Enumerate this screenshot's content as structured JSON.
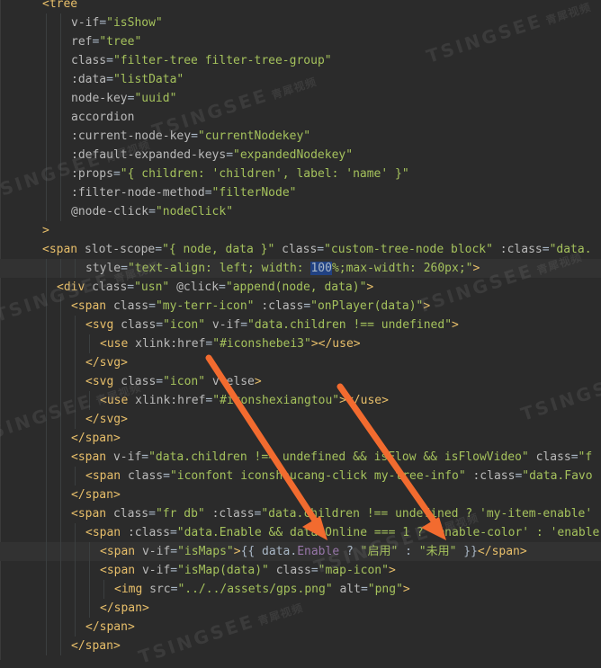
{
  "editor": {
    "lines": [
      {
        "indent": 0,
        "hl": false,
        "tokens": [
          [
            "tag",
            "<tree"
          ]
        ]
      },
      {
        "indent": 2,
        "hl": false,
        "tokens": [
          [
            "attr",
            "v-if"
          ],
          [
            "plain",
            "="
          ],
          [
            "str",
            "\"isShow\""
          ]
        ]
      },
      {
        "indent": 2,
        "hl": false,
        "tokens": [
          [
            "attr",
            "ref"
          ],
          [
            "plain",
            "="
          ],
          [
            "str",
            "\"tree\""
          ]
        ]
      },
      {
        "indent": 2,
        "hl": false,
        "tokens": [
          [
            "attr",
            "class"
          ],
          [
            "plain",
            "="
          ],
          [
            "str",
            "\"filter-tree filter-tree-group\""
          ]
        ]
      },
      {
        "indent": 2,
        "hl": false,
        "tokens": [
          [
            "attr",
            ":data"
          ],
          [
            "plain",
            "="
          ],
          [
            "str",
            "\"listData\""
          ]
        ]
      },
      {
        "indent": 2,
        "hl": false,
        "tokens": [
          [
            "attr",
            "node-key"
          ],
          [
            "plain",
            "="
          ],
          [
            "str",
            "\"uuid\""
          ]
        ]
      },
      {
        "indent": 2,
        "hl": false,
        "tokens": [
          [
            "attr",
            "accordion"
          ]
        ]
      },
      {
        "indent": 2,
        "hl": false,
        "tokens": [
          [
            "attr",
            ":current-node-key"
          ],
          [
            "plain",
            "="
          ],
          [
            "str",
            "\"currentNodekey\""
          ]
        ]
      },
      {
        "indent": 2,
        "hl": false,
        "tokens": [
          [
            "attr",
            ":default-expanded-keys"
          ],
          [
            "plain",
            "="
          ],
          [
            "str",
            "\"expandedNodekey\""
          ]
        ]
      },
      {
        "indent": 2,
        "hl": false,
        "tokens": [
          [
            "attr",
            ":props"
          ],
          [
            "plain",
            "="
          ],
          [
            "str",
            "\"{ children: 'children', label: 'name' }\""
          ]
        ]
      },
      {
        "indent": 2,
        "hl": false,
        "tokens": [
          [
            "attr",
            ":filter-node-method"
          ],
          [
            "plain",
            "="
          ],
          [
            "str",
            "\"filterNode\""
          ]
        ]
      },
      {
        "indent": 2,
        "hl": false,
        "tokens": [
          [
            "attr",
            "@node-click"
          ],
          [
            "plain",
            "="
          ],
          [
            "str",
            "\"nodeClick\""
          ]
        ]
      },
      {
        "indent": 0,
        "hl": false,
        "tokens": [
          [
            "tag",
            ">"
          ]
        ]
      },
      {
        "indent": 0,
        "hl": false,
        "tokens": [
          [
            "tag",
            "<span "
          ],
          [
            "attr",
            "slot-scope"
          ],
          [
            "plain",
            "="
          ],
          [
            "str",
            "\"{ node, data }\" "
          ],
          [
            "attr",
            "class"
          ],
          [
            "plain",
            "="
          ],
          [
            "str",
            "\"custom-tree-node block\" "
          ],
          [
            "attr",
            ":class"
          ],
          [
            "plain",
            "="
          ],
          [
            "str",
            "\"data."
          ]
        ]
      },
      {
        "indent": 3,
        "hl": true,
        "tokens": [
          [
            "attr",
            "style"
          ],
          [
            "plain",
            "="
          ],
          [
            "str",
            "\"text-align: left; width: "
          ],
          [
            "sel",
            "100"
          ],
          [
            "str",
            "%;max-width: 260px;\""
          ],
          [
            "tag",
            ">"
          ]
        ]
      },
      {
        "indent": 1,
        "hl": false,
        "tokens": [
          [
            "tag",
            "<div "
          ],
          [
            "attr",
            "class"
          ],
          [
            "plain",
            "="
          ],
          [
            "str",
            "\"usn\" "
          ],
          [
            "attr",
            "@click"
          ],
          [
            "plain",
            "="
          ],
          [
            "str",
            "\"append(node, data)\""
          ],
          [
            "tag",
            ">"
          ]
        ]
      },
      {
        "indent": 2,
        "hl": false,
        "tokens": [
          [
            "tag",
            "<span "
          ],
          [
            "attr",
            "class"
          ],
          [
            "plain",
            "="
          ],
          [
            "str",
            "\"my-terr-icon\" "
          ],
          [
            "attr",
            ":class"
          ],
          [
            "plain",
            "="
          ],
          [
            "str",
            "\"onPlayer(data)\""
          ],
          [
            "tag",
            ">"
          ]
        ]
      },
      {
        "indent": 3,
        "hl": false,
        "tokens": [
          [
            "tag",
            "<svg "
          ],
          [
            "attr",
            "class"
          ],
          [
            "plain",
            "="
          ],
          [
            "str",
            "\"icon\" "
          ],
          [
            "attr",
            "v-if"
          ],
          [
            "plain",
            "="
          ],
          [
            "str",
            "\"data.children !== undefined\""
          ],
          [
            "tag",
            ">"
          ]
        ]
      },
      {
        "indent": 4,
        "hl": false,
        "tokens": [
          [
            "tag",
            "<use "
          ],
          [
            "attr",
            "xlink:href"
          ],
          [
            "plain",
            "="
          ],
          [
            "str",
            "\"#iconshebei3\""
          ],
          [
            "tag",
            "></use>"
          ]
        ]
      },
      {
        "indent": 3,
        "hl": false,
        "tokens": [
          [
            "tag",
            "</svg>"
          ]
        ]
      },
      {
        "indent": 3,
        "hl": false,
        "tokens": [
          [
            "tag",
            "<svg "
          ],
          [
            "attr",
            "class"
          ],
          [
            "plain",
            "="
          ],
          [
            "str",
            "\"icon\" "
          ],
          [
            "attr",
            "v-else"
          ],
          [
            "tag",
            ">"
          ]
        ]
      },
      {
        "indent": 4,
        "hl": false,
        "tokens": [
          [
            "tag",
            "<use "
          ],
          [
            "attr",
            "xlink:href"
          ],
          [
            "plain",
            "="
          ],
          [
            "str",
            "\"#iconshexiangtou\""
          ],
          [
            "tag",
            "></use>"
          ]
        ]
      },
      {
        "indent": 3,
        "hl": false,
        "tokens": [
          [
            "tag",
            "</svg>"
          ]
        ]
      },
      {
        "indent": 2,
        "hl": false,
        "tokens": [
          [
            "tag",
            "</span>"
          ]
        ]
      },
      {
        "indent": 2,
        "hl": false,
        "tokens": [
          [
            "tag",
            "<span "
          ],
          [
            "attr",
            "v-if"
          ],
          [
            "plain",
            "="
          ],
          [
            "str",
            "\"data.children !== undefined && isFlow && isFlowVideo\" "
          ],
          [
            "attr",
            "class"
          ],
          [
            "plain",
            "="
          ],
          [
            "str",
            "\"f"
          ]
        ]
      },
      {
        "indent": 3,
        "hl": false,
        "tokens": [
          [
            "tag",
            "<span "
          ],
          [
            "attr",
            "class"
          ],
          [
            "plain",
            "="
          ],
          [
            "str",
            "\"iconfont iconshoucang-click my-tree-info\" "
          ],
          [
            "attr",
            ":class"
          ],
          [
            "plain",
            "="
          ],
          [
            "str",
            "\"data.Favo"
          ]
        ]
      },
      {
        "indent": 2,
        "hl": false,
        "tokens": [
          [
            "tag",
            "</span>"
          ]
        ]
      },
      {
        "indent": 2,
        "hl": false,
        "tokens": [
          [
            "tag",
            "<span "
          ],
          [
            "attr",
            "class"
          ],
          [
            "plain",
            "="
          ],
          [
            "str",
            "\"fr db\" "
          ],
          [
            "attr",
            ":class"
          ],
          [
            "plain",
            "="
          ],
          [
            "str",
            "\"data.children !== undefined ? 'my-item-enable'"
          ]
        ]
      },
      {
        "indent": 3,
        "hl": false,
        "tokens": [
          [
            "tag",
            "<span "
          ],
          [
            "attr",
            ":class"
          ],
          [
            "plain",
            "="
          ],
          [
            "str",
            "\"data.Enable && data.Online === 1 ? 'enable-color' : 'enable-"
          ]
        ]
      },
      {
        "indent": 4,
        "hl": true,
        "tokens": [
          [
            "tag",
            "<span "
          ],
          [
            "attr",
            "v-if"
          ],
          [
            "plain",
            "="
          ],
          [
            "str",
            "\"isMaps\""
          ],
          [
            "tag",
            ">"
          ],
          [
            "plain",
            "{{ data."
          ],
          [
            "var",
            "Enable"
          ],
          [
            "plain",
            " ? "
          ],
          [
            "str",
            "\"启用\""
          ],
          [
            "plain",
            " : "
          ],
          [
            "str",
            "\"未用\""
          ],
          [
            "plain",
            " }}"
          ],
          [
            "tag",
            "</span>"
          ]
        ]
      },
      {
        "indent": 4,
        "hl": false,
        "tokens": [
          [
            "tag",
            "<span "
          ],
          [
            "attr",
            "v-if"
          ],
          [
            "plain",
            "="
          ],
          [
            "str",
            "\"isMap(data)\" "
          ],
          [
            "attr",
            "class"
          ],
          [
            "plain",
            "="
          ],
          [
            "str",
            "\"map-icon\""
          ],
          [
            "tag",
            ">"
          ]
        ]
      },
      {
        "indent": 5,
        "hl": false,
        "tokens": [
          [
            "tag",
            "<img "
          ],
          [
            "attr",
            "src"
          ],
          [
            "plain",
            "="
          ],
          [
            "str",
            "\"../../assets/gps.png\" "
          ],
          [
            "attr",
            "alt"
          ],
          [
            "plain",
            "="
          ],
          [
            "str",
            "\"png\""
          ],
          [
            "tag",
            ">"
          ]
        ]
      },
      {
        "indent": 4,
        "hl": false,
        "tokens": [
          [
            "tag",
            "</span>"
          ]
        ]
      },
      {
        "indent": 3,
        "hl": false,
        "tokens": [
          [
            "tag",
            "</span>"
          ]
        ]
      },
      {
        "indent": 2,
        "hl": false,
        "tokens": [
          [
            "tag",
            "</span>"
          ]
        ]
      }
    ]
  },
  "watermark": {
    "brand": "TSINGSEE",
    "sub": "青犀视频"
  },
  "colors": {
    "arrow": "#f26b2f",
    "tag": "#e8bf6a",
    "attr": "#bababa",
    "string": "#a5c25c",
    "background": "#2b2b2b"
  }
}
